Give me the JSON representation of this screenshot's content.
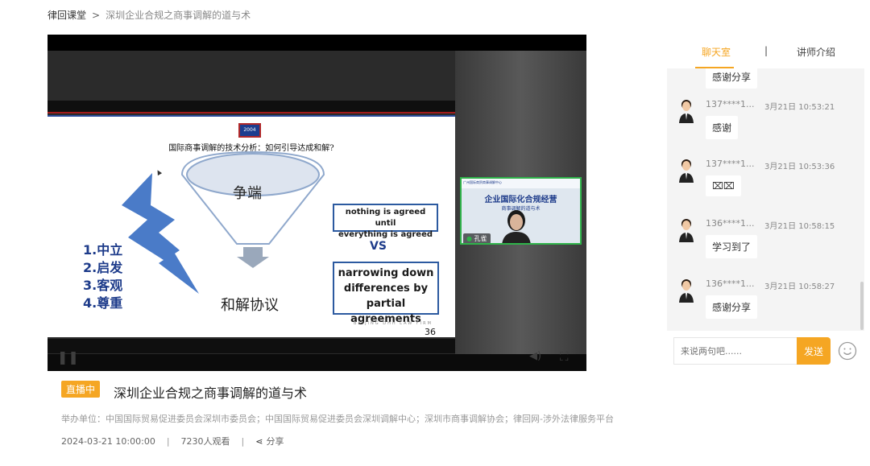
{
  "breadcrumb": {
    "home": "律回课堂",
    "separator": ">",
    "current": "深圳企业合规之商事调解的道与术"
  },
  "slide": {
    "logo_text": "2004 ADR",
    "title": "国际商事调解的技术分析：如何引导达成和解?",
    "funnel_top": "争端",
    "funnel_bottom": "和解协议",
    "principles": [
      "1.中立",
      "2.启发",
      "3.客观",
      "4.尊重"
    ],
    "box1": [
      "nothing is agreed until",
      "everything is agreed"
    ],
    "vs": "VS",
    "box2": [
      "narrowing down",
      "differences by",
      "partial agreements"
    ],
    "firm": "BEIJING DHH LAW FIRM",
    "page_number": "36"
  },
  "pip": {
    "header": "广州国际商贸商事调解中心",
    "title": "企业国际化合规经营",
    "subtitle": "商事调解的道与术",
    "speaker_name": "孔雀"
  },
  "info": {
    "live_badge": "直播中",
    "title": "深圳企业合规之商事调解的道与术",
    "organizers": "举办单位：中国国际贸易促进委员会深圳市委员会；中国国际贸易促进委员会深圳调解中心；深圳市商事调解协会；律回网-涉外法律服务平台",
    "date": "2024-03-21 10:00:00",
    "divider": "|",
    "viewers": "7230人观看",
    "share": "分享"
  },
  "chat": {
    "tab_chat": "聊天室",
    "tab_sep": "|",
    "tab_lecturer": "讲师介绍",
    "top_bubble": "感谢分享",
    "messages": [
      {
        "user": "137****1...",
        "time": "3月21日 10:53:21",
        "text": "感谢"
      },
      {
        "user": "137****1...",
        "time": "3月21日 10:53:36",
        "text": "⌧⌧"
      },
      {
        "user": "136****1...",
        "time": "3月21日 10:58:15",
        "text": "学习到了"
      },
      {
        "user": "136****1...",
        "time": "3月21日 10:58:27",
        "text": "感谢分享"
      }
    ],
    "input_placeholder": "来说两句吧......",
    "send_label": "发送"
  },
  "colors": {
    "accent": "#f5a623",
    "slide_blue": "#1d3b8a",
    "pip_border": "#2fb34a"
  }
}
